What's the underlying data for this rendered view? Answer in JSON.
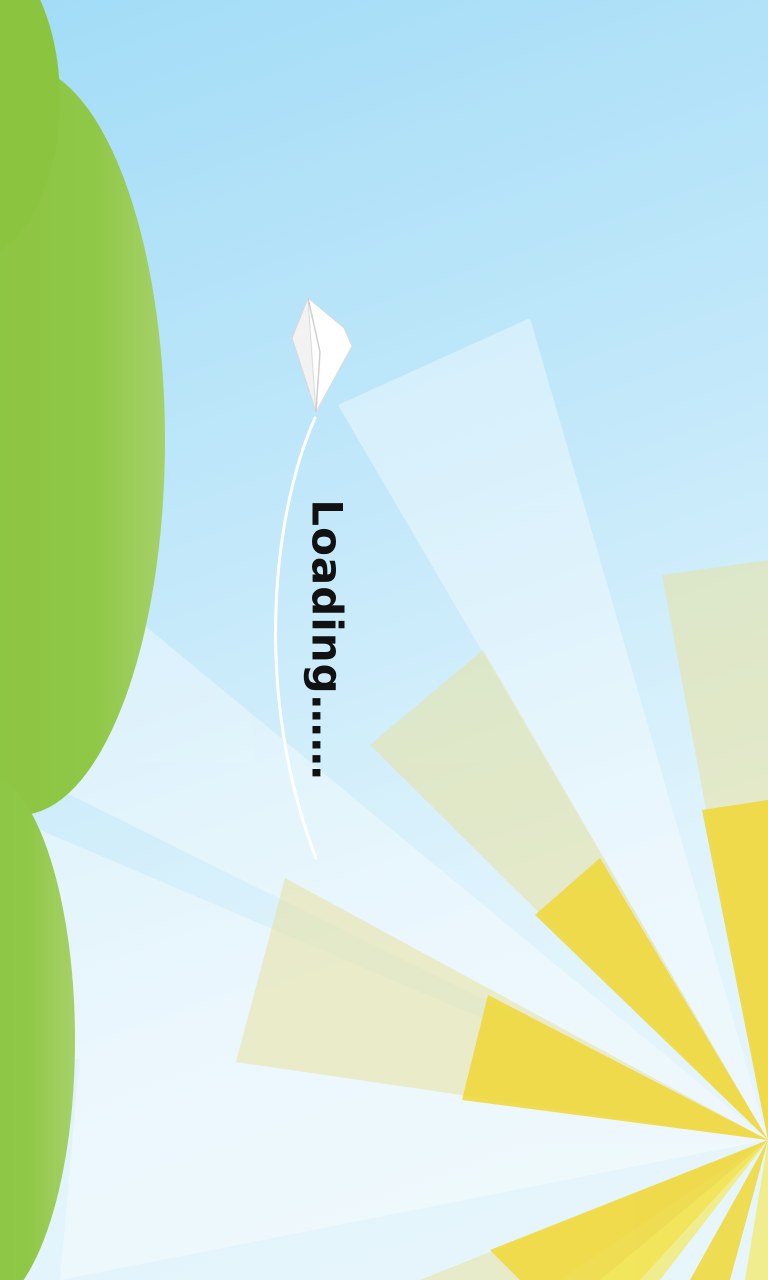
{
  "loading": {
    "label": "Loading……"
  },
  "colors": {
    "sky_top": "#a2dcf7",
    "sky_bottom": "#e8f6fb",
    "hill_green": "#8dc63f",
    "sunray_yellow": "#f2dc3c",
    "pale_ray": "#f0f4d8",
    "trail": "#ffffff"
  },
  "icons": {
    "plane": "paper-plane-icon"
  }
}
